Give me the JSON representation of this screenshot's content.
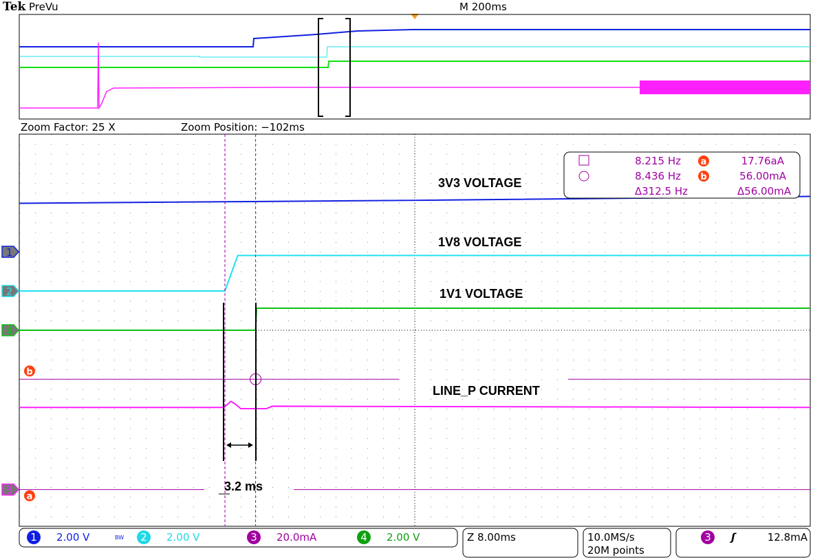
{
  "header": {
    "brand": "Tek",
    "mode": "PreVu",
    "timebase": "M 200ms"
  },
  "zoom": {
    "factor_label": "Zoom Factor: 25 X",
    "position_label": "Zoom Position: −102ms"
  },
  "colors": {
    "ch1": "#1020e0",
    "ch2": "#20e0f0",
    "ch3": "#ff20ff",
    "ch4": "#10c010",
    "cursor": "#a000a0",
    "cursor_badge": "#ff4010",
    "trigger": "#f0a020"
  },
  "chart_data": {
    "type": "line",
    "title": "",
    "x_unit": "ms",
    "xlim": [
      -40,
      40
    ],
    "x_divisions": 10,
    "y_divisions": 8,
    "grid": true,
    "series": [
      {
        "channel": "1",
        "name": "3V3 VOLTAGE",
        "unit": "V",
        "scale_per_div": 2.0,
        "ground_div": 1.6,
        "points": [
          [
            -40,
            1.98
          ],
          [
            0,
            2.1
          ],
          [
            40,
            2.26
          ]
        ]
      },
      {
        "channel": "2",
        "name": "1V8 VOLTAGE",
        "unit": "V",
        "scale_per_div": 2.0,
        "ground_div": 0.8,
        "points": [
          [
            -40,
            0
          ],
          [
            -19.2,
            0
          ],
          [
            -17.9,
            1.45
          ],
          [
            40,
            1.45
          ]
        ]
      },
      {
        "channel": "4",
        "name": "1V1 VOLTAGE",
        "unit": "V",
        "scale_per_div": 2.0,
        "ground_div": 0,
        "points": [
          [
            -40,
            0
          ],
          [
            -16.1,
            0
          ],
          [
            -16.0,
            0.9
          ],
          [
            40,
            0.9
          ]
        ]
      },
      {
        "channel": "3",
        "name": "LINE_P CURRENT",
        "unit": "mA",
        "scale_per_div": 20.0,
        "ground_div": -3.25,
        "points": [
          [
            -40,
            33.5
          ],
          [
            -19.3,
            33.5
          ],
          [
            -18.6,
            36
          ],
          [
            -18.2,
            35
          ],
          [
            -17.6,
            33
          ],
          [
            -16.5,
            33
          ],
          [
            -16.1,
            33
          ],
          [
            -15.0,
            33
          ],
          [
            -14.4,
            34
          ],
          [
            40,
            33.5
          ]
        ]
      }
    ],
    "vertical_cursors_ms": [
      -19.2,
      -16.1
    ],
    "horizontal_cursors_mA": {
      "a": 0,
      "b": 45
    },
    "annotations": [
      {
        "text": "3V3 VOLTAGE"
      },
      {
        "text": "1V8 VOLTAGE"
      },
      {
        "text": "1V1 VOLTAGE"
      },
      {
        "text": "LINE_P CURRENT"
      },
      {
        "text": "3.2 ms"
      }
    ]
  },
  "readout": {
    "cursor1_freq": "8.215 Hz",
    "cursor2_freq": "8.436 Hz",
    "delta_freq": "Δ312.5 Hz",
    "a_label": "a",
    "a_value": "17.76aA",
    "b_label": "b",
    "b_value": "56.00mA",
    "delta_value": "Δ56.00mA"
  },
  "markers": {
    "ch1": "1",
    "ch2": "2",
    "ch3": "3",
    "ch4": "4",
    "a": "a",
    "b": "b"
  },
  "status": {
    "ch1_num": "1",
    "ch1_scale": "2.00 V",
    "bw": "BW",
    "ch2_num": "2",
    "ch2_scale": "2.00 V",
    "ch3_num": "3",
    "ch3_scale": "20.0mA",
    "ch4_num": "4",
    "ch4_scale": "2.00 V",
    "zoom_scale": "Z 8.00ms",
    "sample_rate": "10.0MS/s",
    "record_length": "20M points",
    "trigger_source": "3",
    "trigger_slope_icon": "rising-edge-icon",
    "trigger_slope": "ʃ",
    "trigger_level": "12.8mA"
  }
}
